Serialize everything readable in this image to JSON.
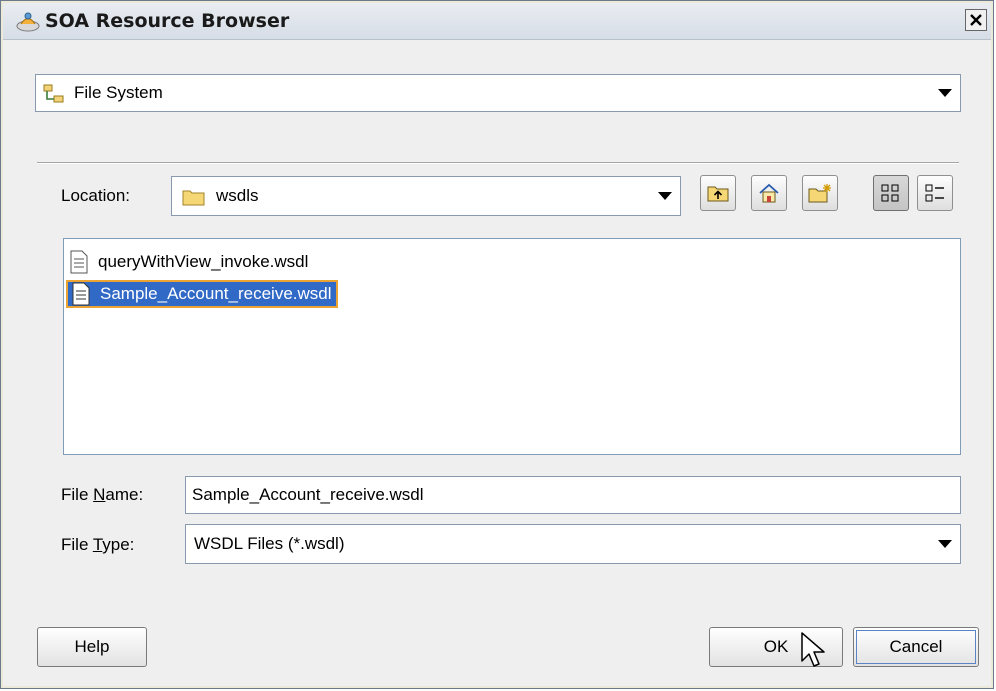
{
  "window": {
    "title": "SOA Resource Browser"
  },
  "source_combo": {
    "value": "File System"
  },
  "location": {
    "label": "Location:",
    "value": "wsdls",
    "buttons": [
      "up-one-level",
      "home",
      "new-folder",
      "list-view",
      "details-view"
    ]
  },
  "files": [
    {
      "name": "queryWithView_invoke.wsdl",
      "selected": false
    },
    {
      "name": "Sample_Account_receive.wsdl",
      "selected": true
    }
  ],
  "file_name": {
    "label": "File Name:",
    "value": "Sample_Account_receive.wsdl"
  },
  "file_type": {
    "label": "File Type:",
    "value": "WSDL Files (*.wsdl)"
  },
  "buttons": {
    "help": "Help",
    "ok": "OK",
    "cancel": "Cancel"
  },
  "colors": {
    "selection": "#3169c6",
    "dialog_bg": "#efefef"
  }
}
